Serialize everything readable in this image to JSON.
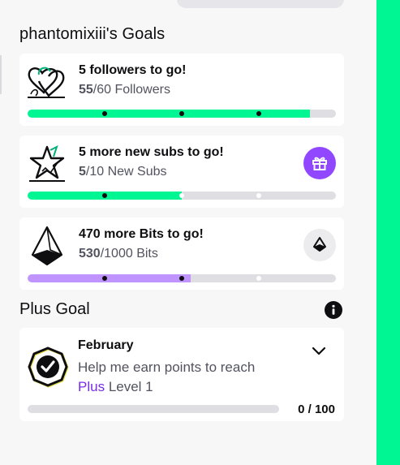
{
  "goals": {
    "title": "phantomixiii's Goals",
    "cards": [
      {
        "headline": "5 followers to go!",
        "current": "55",
        "rest": "/60 Followers",
        "progress": 0.916,
        "bar_color": "#00f593",
        "markers": [
          0.25,
          0.5,
          0.75
        ],
        "icon": "hearts-icon"
      },
      {
        "headline": "5 more new subs to go!",
        "current": "5",
        "rest": "/10 New Subs",
        "progress": 0.5,
        "bar_color": "#00f593",
        "markers": [
          0.25,
          0.5,
          0.75
        ],
        "icon": "star-icon",
        "action_icon": "gift-icon",
        "action_color": "#9147ff"
      },
      {
        "headline": "470 more Bits to go!",
        "current": "530",
        "rest": "/1000 Bits",
        "progress": 0.53,
        "bar_color": "#bf94ff",
        "markers": [
          0.25,
          0.5,
          0.75
        ],
        "icon": "bits-gem-icon",
        "action_icon": "bits-icon"
      }
    ]
  },
  "plus_goal": {
    "title": "Plus Goal",
    "month": "February",
    "desc_prefix": "Help me earn points to reach",
    "plus_word": "Plus",
    "desc_suffix": "Level 1",
    "counter": "0 / 100",
    "progress": 0,
    "icon": "checkmark-badge-icon"
  },
  "colors": {
    "accent_green": "#00f593",
    "accent_purple": "#9147ff",
    "bits_purple": "#bf94ff"
  }
}
